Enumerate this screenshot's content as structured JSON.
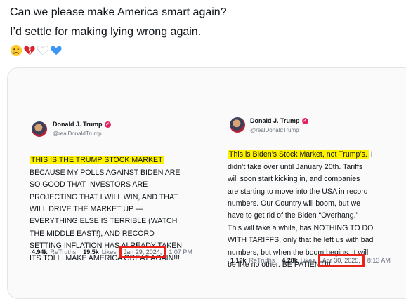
{
  "post": {
    "line1": "Can we please make America smart again?",
    "line2": "I’d settle for making lying wrong again.",
    "emojis": [
      "crying-face-icon",
      "broken-heart-icon",
      "white-heart-icon",
      "blue-heart-icon"
    ]
  },
  "left_tweet": {
    "author": "Donald J. Trump",
    "handle": "@realDonaldTrump",
    "highlight": "THIS IS THE TRUMP STOCK MARKET",
    "body": "BECAUSE MY POLLS AGAINST BIDEN ARE\nSO GOOD THAT INVESTORS ARE\nPROJECTING THAT I WILL WIN, AND THAT\nWILL DRIVE THE MARKET UP —\nEVERYTHING ELSE IS TERRIBLE (WATCH\nTHE MIDDLE EAST!), AND RECORD\nSETTING INFLATION HAS ALREADY TAKEN\nITS TOLL. MAKE AMERICA GREAT AGAIN!!!",
    "retruths": "4.94k",
    "retruths_label": "ReTruths",
    "likes": "19.5k",
    "likes_label": "Likes",
    "date": "Jan 29, 2024,",
    "time": "1:07 PM"
  },
  "right_tweet": {
    "author": "Donald J. Trump",
    "handle": "@realDonaldTrump",
    "highlight": "This is Biden’s Stock Market, not Trump’s.",
    "body_first_suffix": " I",
    "body": "didn’t take over until January 20th. Tariffs\nwill soon start kicking in, and companies\nare starting to move into the USA in record\nnumbers. Our Country will boom, but we\nhave to get rid of the Biden “Overhang.”\nThis will take a while, has NOTHING TO DO\nWITH TARIFFS, only that he left us with bad\nnumbers, but when the boom begins, it will\nbe like no other. BE PATIENT!!!",
    "retruths": "1.19k",
    "retruths_label": "ReTruths",
    "likes": "4.28k",
    "likes_label": "Likes",
    "date": "Apr 30, 2025,",
    "time": "8:13 AM"
  },
  "colors": {
    "highlight": "#fff200",
    "red_box": "#e8231a",
    "badge": "#e0245e"
  }
}
